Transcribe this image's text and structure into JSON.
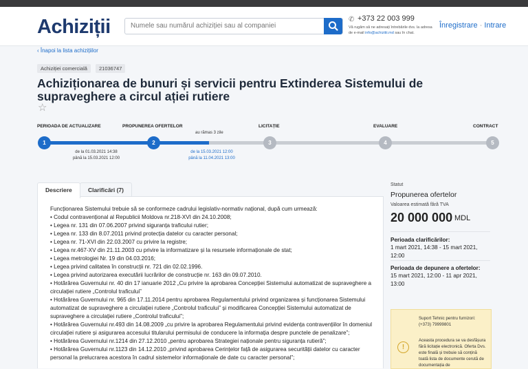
{
  "header": {
    "logo": "Achiziții",
    "search_placeholder": "Numele sau numărul achiziției sau al companiei",
    "phone": "+373 22 003 999",
    "call_info_1": "Vă rugăm să ne adresați întrebările dvs. la adresa",
    "call_info_2a": "de e-mail ",
    "call_info_email": "info@achizitii.md",
    "call_info_2b": " sau în chat.",
    "register": "Înregistrare",
    "separator": " · ",
    "login": "Intrare"
  },
  "back_link": "‹ Înapoi la lista achizițiilor",
  "tags": [
    "Achiziției comercială",
    "21036747"
  ],
  "title": "Achiziționarea de bunuri și servicii pentru Extinderea Sistemului de supraveghere a circul ației rutiere",
  "favorite_icon": "star-outline-icon",
  "stages": {
    "labels": [
      "PERIOADA DE ACTUALIZARE",
      "PROPUNEREA OFERTELOR",
      "LICITAȚIE",
      "EVALUARE",
      "CONTRACT"
    ],
    "numbers": [
      "1",
      "2",
      "3",
      "4",
      "5"
    ],
    "current_stage": 2,
    "remaining": "au rămas 3 zile",
    "stage1_dates": [
      "de la 01.03.2021 14:38",
      "până la 15.03.2021 12:00"
    ],
    "stage2_dates": [
      "de la 15.03.2021 12:00",
      "până la 11.04.2021 13:00"
    ]
  },
  "tabs": [
    "Descriere",
    "Clarificări (7)"
  ],
  "description": [
    "Funcționarea Sistemului trebuie să se conformeze cadrului legislativ-normativ național, după cum urmează:",
    "• Codul contravențional al Republicii Moldova nr.218-XVI din 24.10.2008;",
    "• Legea nr. 131 din 07.06.2007 privind siguranța traficului rutier;",
    "• Legea nr. 133 din 8.07.2011 privind protecția datelor cu caracter personal;",
    "• Legea nr. 71-XVI din 22.03.2007 cu privire la registre;",
    "• Legea nr.467-XV din 21.11.2003 cu privire la informatizare și la resursele informaționale de stat;",
    "• Legea metrologiei Nr. 19 din 04.03.2016;",
    "• Legea privind calitatea în construcții nr. 721 din 02.02.1996.",
    "• Legea privind autorizarea executării lucrărilor de construcție nr. 163 din 09.07.2010.",
    "• Hotărârea Guvernului nr. 40 din 17 ianuarie 2012 „Cu privire la aprobarea Concepției Sistemului automatizat de supraveghere a circulației rutiere „Controlul traficului”",
    "• Hotărârea Guvernului nr. 965 din 17.11.2014 pentru aprobarea Regulamentului privind organizarea și funcționarea Sistemului automatizat de supraveghere a circulației rutiere „Controlul traficului” și modificarea Concepției Sistemului automatizat de supraveghere a circulației rutiere „Controlul traficului”;",
    "• Hotărârea Guvernului nr.493 din 14.08.2009 „cu privire la aprobarea Regulamentului privind evidența contravențiilor în domeniul circulației rutiere și asigurarea accesului titularului permisului de conducere la informația despre punctele de penalizare”;",
    "• Hotărârea Guvernului nr.1214 din 27.12.2010 „pentru aprobarea Strategiei naționale pentru siguranța rutieră”;",
    "• Hotărârea Guvernului nr.1123 din 14.12.2010 „privind aprobarea Cerințelor față de asigurarea securității datelor cu caracter personal la prelucrarea acestora în cadrul sistemelor informaționale de date cu caracter personal”;"
  ],
  "sidebar": {
    "status_label": "Statut",
    "status_value": "Propunerea ofertelor",
    "value_label": "Valoarea estimată fără TVA",
    "amount": "20 000 000",
    "currency": "MDL",
    "clarif_title": "Perioada clarificărilor:",
    "clarif_period": "1 mart 2021, 14:38 - 15 mart 2021, 12:00",
    "offers_title": "Perioada de depunere a ofertelor:",
    "offers_period": "15 mart 2021, 12:00 - 11 apr 2021, 13:00",
    "support_title": "Suport Tehnic pentru furnizori:",
    "support_phone": "(+373) 79999801",
    "warning": "Aceasta procedura se va desfășura fără licitație electronică. Oferta Dvs. este finală și trebuie să conțină toată lista de documente cerută de documentația de"
  },
  "colors": {
    "accent": "#1d6cc9",
    "brand": "#1e3a6e",
    "warning_bg": "#fbf0c8"
  }
}
